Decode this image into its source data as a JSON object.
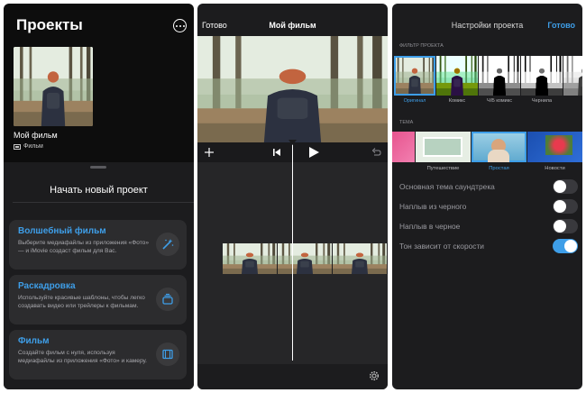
{
  "projects": {
    "title": "Проекты",
    "item": {
      "name": "Мой фильм",
      "type": "Фильм"
    },
    "sheet": {
      "title": "Начать новый проект",
      "cards": [
        {
          "title": "Волшебный фильм",
          "desc": "Выберите медиафайлы из приложения «Фото» — и iMovie создаст фильм для Вас."
        },
        {
          "title": "Раскадровка",
          "desc": "Используйте красивые шаблоны, чтобы легко создавать видео или трейлеры к фильмам."
        },
        {
          "title": "Фильм",
          "desc": "Создайте фильм с нуля, используя медиафайлы из приложения «Фото» и камеру."
        }
      ]
    }
  },
  "editor": {
    "done_label": "Готово",
    "title": "Мой фильм"
  },
  "settings": {
    "title": "Настройки проекта",
    "done_label": "Готово",
    "filter_section": "Фильтр проекта",
    "filters": [
      "Оригинал",
      "Комикс",
      "Ч/Б комикс",
      "Чернила",
      ""
    ],
    "selected_filter": "Оригинал",
    "theme_section": "Тема",
    "themes": [
      "",
      "Путешествие",
      "Простая",
      "Новости"
    ],
    "selected_theme": "Простая",
    "toggles": [
      {
        "label": "Основная тема саундтрека",
        "on": false
      },
      {
        "label": "Наплыв из черного",
        "on": false
      },
      {
        "label": "Наплыв в черное",
        "on": false
      },
      {
        "label": "Тон зависит от скорости",
        "on": true
      }
    ]
  },
  "colors": {
    "accent": "#3e9ee8",
    "panel": "#1c1c1e",
    "card": "#2c2c2e"
  }
}
